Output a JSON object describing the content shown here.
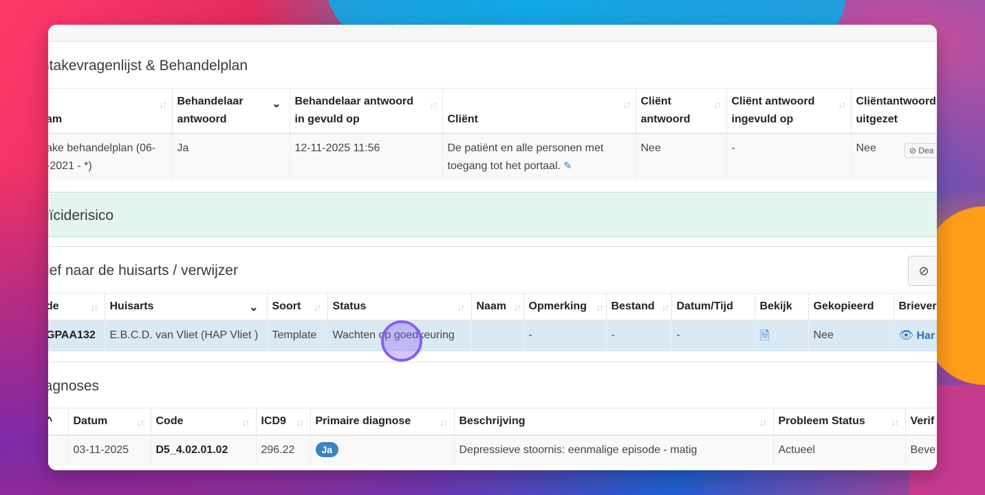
{
  "intake": {
    "title": "ntakevragenlijst & Behandelplan",
    "headers": [
      "am",
      "Behandelaar antwoord",
      "Behandelaar antwoord in gevuld op",
      "Cliënt",
      "Cliënt antwoord",
      "Cliënt antwoord ingevuld op",
      "Cliëntantwoord uitgezet"
    ],
    "header_lines": {
      "c1a": "Behandelaar",
      "c1b": "antwoord",
      "c2a": "Behandelaar antwoord",
      "c2b": "in gevuld op",
      "c4a": "Cliënt",
      "c4b": "antwoord",
      "c5a": "Cliënt antwoord",
      "c5b": "ingevuld op",
      "c6a": "Cliëntantwoord",
      "c6b": "uitgezet"
    },
    "row": {
      "name_line1": "ake behandelplan (06-",
      "name_line2": "-2021 - *)",
      "behandelaar_antwoord": "Ja",
      "ingevuld_op": "12-11-2025 11:56",
      "client_line1": "De patiënt en alle personen met",
      "client_line2": "toegang tot het portaal.",
      "client_antwoord": "Nee",
      "client_ingevuld": "-",
      "uitgezet": "Nee",
      "action_label": "Dea"
    }
  },
  "suicide": {
    "title": "uïciderisico"
  },
  "brief": {
    "title": "rief naar de huisarts / verwijzer",
    "headers": [
      "de",
      "Huisarts",
      "Soort",
      "Status",
      "Naam",
      "Opmerking",
      "Bestand",
      "Datum/Tijd",
      "Bekijk",
      "Gekopieerd",
      "Briever"
    ],
    "row": {
      "code": "GPAA132",
      "huisarts": "E.B.C.D. van Vliet (HAP Vliet )",
      "soort": "Template",
      "status": "Wachten op goedkeuring",
      "naam": "",
      "opmerking": "-",
      "bestand": "-",
      "datum": "-",
      "bekijk_icon": "document-icon",
      "gekopieerd": "Nee",
      "brieven_label": "Har"
    }
  },
  "diagnoses": {
    "title": "iagnoses",
    "headers": [
      "",
      "Datum",
      "Code",
      "ICD9",
      "Primaire diagnose",
      "Beschrijving",
      "Probleem Status",
      "Verif"
    ],
    "row": {
      "datum": "03-11-2025",
      "code": "D5_4.02.01.02",
      "icd9": "296.22",
      "primair": "Ja",
      "beschrijving": "Depressieve stoornis: eenmalige episode - matig",
      "status": "Actueel",
      "verif": "Beve"
    }
  },
  "colors": {
    "accent": "#3b84c4",
    "selected_row": "#d9eaf5",
    "green_panel": "#e2f6ef",
    "cursor": "#8b5cf6"
  }
}
